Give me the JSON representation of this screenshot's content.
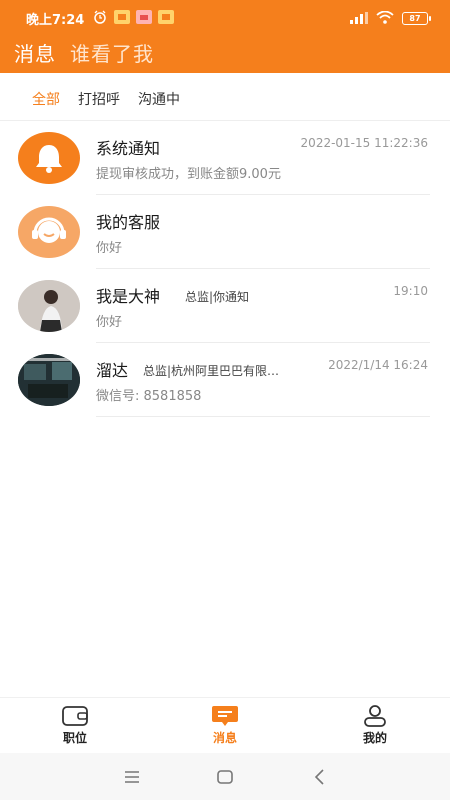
{
  "status_bar": {
    "time": "晚上7:24",
    "battery": "87"
  },
  "header": {
    "tabs": [
      {
        "label": "消息",
        "active": true
      },
      {
        "label": "谁看了我",
        "active": false
      }
    ]
  },
  "filters": [
    {
      "label": "全部",
      "active": true
    },
    {
      "label": "打招呼",
      "active": false
    },
    {
      "label": "沟通中",
      "active": false
    }
  ],
  "messages": [
    {
      "name": "系统通知",
      "tag": "",
      "time": "2022-01-15 11:22:36",
      "preview": "提现审核成功，到账金额9.00元",
      "avatar": "bell-icon"
    },
    {
      "name": "我的客服",
      "tag": "",
      "time": "",
      "preview": "你好",
      "avatar": "headset-icon"
    },
    {
      "name": "我是大神",
      "tag": "总监|你通知",
      "time": "19:10",
      "preview": "你好",
      "avatar": "user-photo"
    },
    {
      "name": "溜达",
      "tag": "总监|杭州阿里巴巴有限…",
      "time": "2022/1/14 16:24",
      "preview": "微信号: 8581858",
      "avatar": "user-photo"
    }
  ],
  "bottom_nav": [
    {
      "label": "职位",
      "icon": "wallet-icon",
      "active": false
    },
    {
      "label": "消息",
      "icon": "message-icon",
      "active": true
    },
    {
      "label": "我的",
      "icon": "profile-icon",
      "active": false
    }
  ],
  "colors": {
    "accent": "#f57f1c",
    "text_primary": "#1a1a1a",
    "text_secondary": "#888888"
  }
}
